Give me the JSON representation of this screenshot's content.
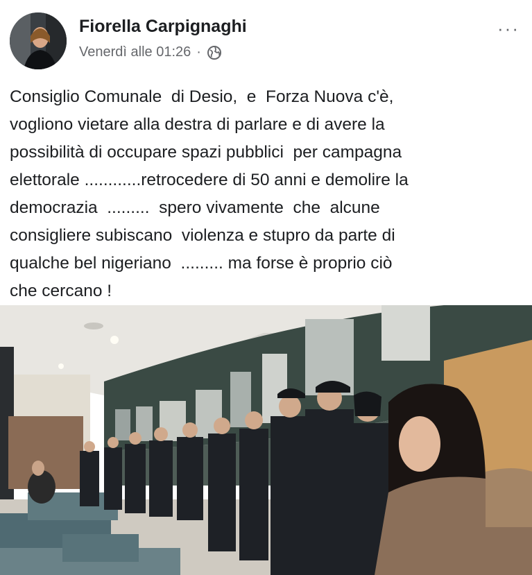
{
  "post": {
    "author": "Fiorella Carpignaghi",
    "timestamp": "Venerdì alle 01:26",
    "more_label": "···",
    "text_lines": [
      "Consiglio Comunale  di Desio,  e  Forza Nuova c'è,",
      "vogliono vietare alla destra di parlare e di avere la",
      "possibilità di occupare spazi pubblici  per campagna",
      "elettorale ............retrocedere di 50 anni e demolire la",
      "democrazia  .........  spero vivamente  che  alcune",
      "consigliere subiscano  violenza e stupro da parte di",
      "qualche bel nigeriano  ......... ma forse è proprio ciò",
      "che cercano !"
    ]
  },
  "icons": {
    "privacy": "globe-icon",
    "menu": "more-options-icon"
  },
  "colors": {
    "text": "#1c1e21",
    "secondary": "#65676b",
    "background": "#ffffff"
  }
}
